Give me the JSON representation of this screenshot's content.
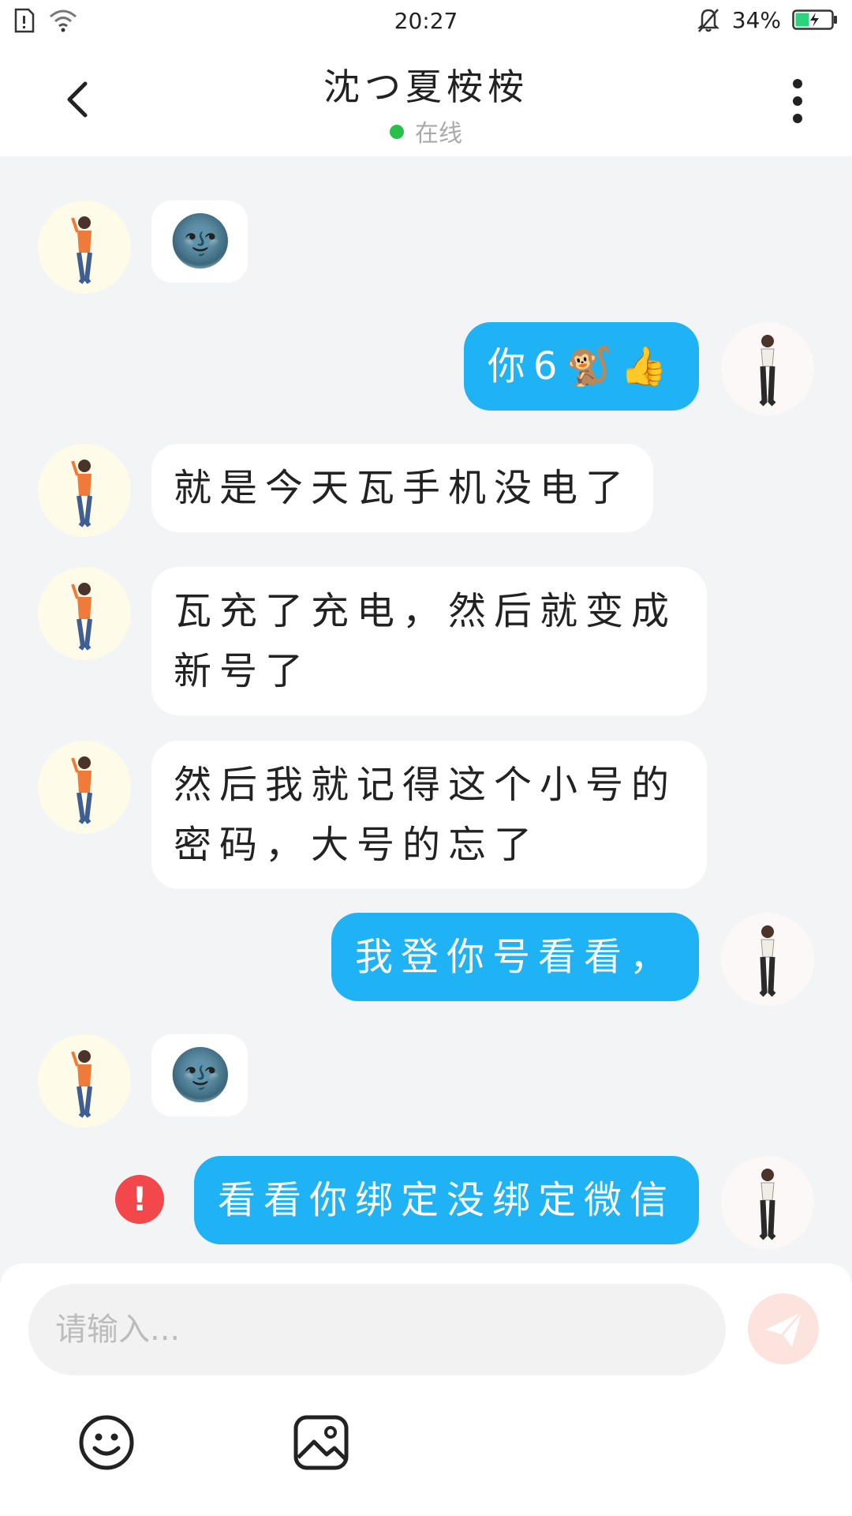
{
  "status_bar": {
    "time": "20:27",
    "battery": "34%"
  },
  "header": {
    "title": "沈つ夏桉桉",
    "presence": "在线"
  },
  "messages": [
    {
      "side": "in",
      "kind": "emoji",
      "text": "🌚"
    },
    {
      "side": "out",
      "kind": "text",
      "text": "你6🐒👍"
    },
    {
      "side": "in",
      "kind": "text",
      "text": "就是今天瓦手机没电了"
    },
    {
      "side": "in",
      "kind": "text",
      "text": "瓦充了充电，然后就变成新号了"
    },
    {
      "side": "in",
      "kind": "text",
      "text": "然后我就记得这个小号的密码，大号的忘了"
    },
    {
      "side": "out",
      "kind": "text",
      "text": "我登你号看看，"
    },
    {
      "side": "in",
      "kind": "emoji",
      "text": "🌚"
    },
    {
      "side": "out",
      "kind": "text",
      "text": "看看你绑定没绑定微信",
      "error": true,
      "error_mark": "!"
    }
  ],
  "composer": {
    "placeholder": "请输入..."
  },
  "icons": {
    "back": "chevron-left-icon",
    "more": "more-vertical-icon",
    "send": "paper-plane-icon",
    "emoji": "smiley-icon",
    "image": "image-icon",
    "error": "error-icon"
  },
  "colors": {
    "outgoing_bubble": "#1fb3f5",
    "online_dot": "#26c04a",
    "error": "#f2474b",
    "send_button": "#fde3de"
  }
}
